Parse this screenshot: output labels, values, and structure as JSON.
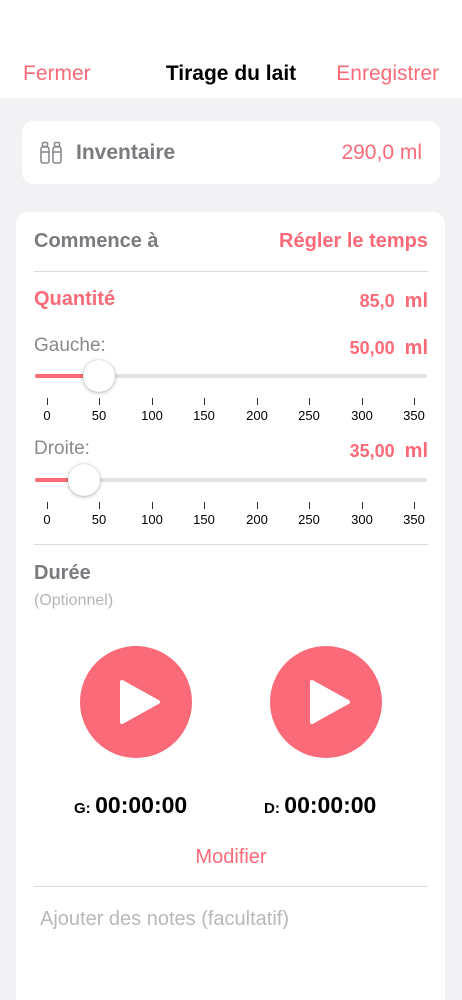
{
  "nav": {
    "close_label": "Fermer",
    "title": "Tirage du lait",
    "save_label": "Enregistrer"
  },
  "inventory": {
    "icon": "milk-bottles-icon",
    "label": "Inventaire",
    "value": "290,0 ml"
  },
  "start": {
    "label": "Commence à",
    "action": "Régler le temps"
  },
  "quantity": {
    "label": "Quantité",
    "value": "85,0",
    "unit": "ml"
  },
  "left_slider": {
    "label": "Gauche:",
    "value": "50,00",
    "unit": "ml",
    "amount": 50,
    "min": 0,
    "max": 350
  },
  "right_slider": {
    "label": "Droite:",
    "value": "35,00",
    "unit": "ml",
    "amount": 35,
    "min": 0,
    "max": 350
  },
  "tick_labels": [
    "0",
    "50",
    "100",
    "150",
    "200",
    "250",
    "300",
    "350"
  ],
  "duration": {
    "label": "Durée",
    "sublabel": "(Optionnel)",
    "left_prefix": "G:",
    "left_time": "00:00:00",
    "right_prefix": "D:",
    "right_time": "00:00:00",
    "play_icon": "play-icon"
  },
  "modify_label": "Modifier",
  "notes_placeholder": "Ajouter des notes (facultatif)",
  "colors": {
    "accent": "#fb6a78",
    "background": "#f2f2f4",
    "secondary_text": "#7a7a7f"
  }
}
